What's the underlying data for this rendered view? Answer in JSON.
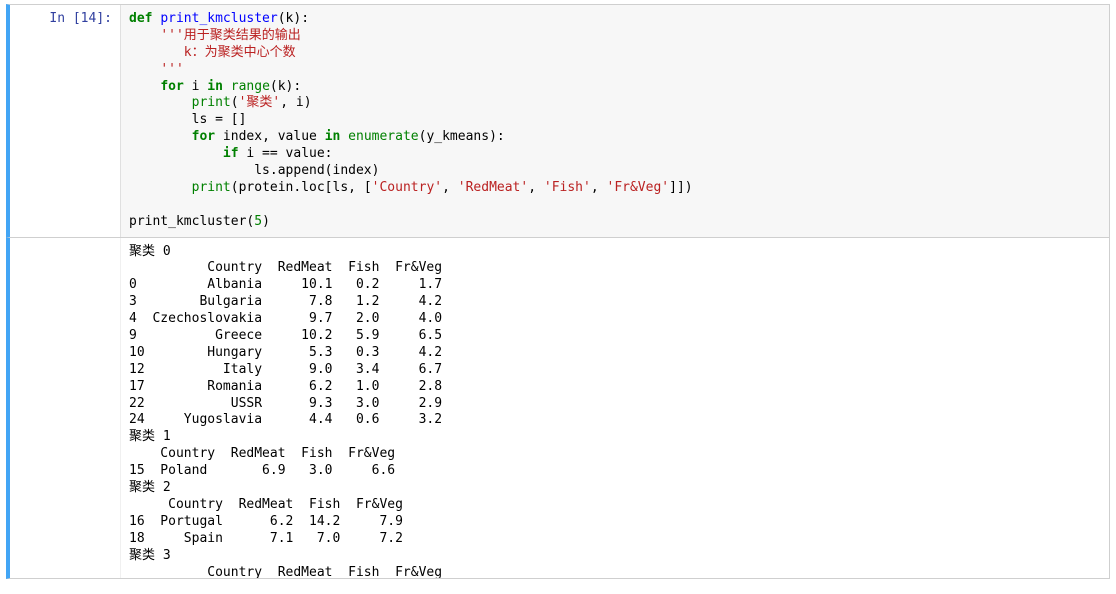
{
  "cell": {
    "prompt_label": "In [14]:",
    "code": {
      "l1_def": "def",
      "l1_fn": "print_kmcluster",
      "l1_rest": "(k):",
      "l2_doc": "'''用于聚类结果的输出",
      "l3_doc": "   k：为聚类中心个数",
      "l4_doc": "'''",
      "l5_for": "for",
      "l5_var": " i ",
      "l5_in": "in",
      "l5_range": " range",
      "l5_rest": "(k):",
      "l6_print": "print",
      "l6_open": "(",
      "l6_str": "'聚类'",
      "l6_rest": ", i)",
      "l7": "ls = []",
      "l8_for": "for",
      "l8_mid": " index, value ",
      "l8_in": "in",
      "l8_enum": " enumerate",
      "l8_rest": "(y_kmeans):",
      "l9_if": "if",
      "l9_rest": " i == value:",
      "l10": "ls.append(index)",
      "l11_print": "print",
      "l11_a": "(protein.loc[ls, [",
      "l11_s1": "'Country'",
      "l11_c1": ", ",
      "l11_s2": "'RedMeat'",
      "l11_c2": ", ",
      "l11_s3": "'Fish'",
      "l11_c3": ", ",
      "l11_s4": "'Fr&Veg'",
      "l11_b": "]])",
      "l13_call": "print_kmcluster(",
      "l13_num": "5",
      "l13_close": ")"
    }
  },
  "output_text": "聚类 0\n          Country  RedMeat  Fish  Fr&Veg\n0         Albania     10.1   0.2     1.7\n3        Bulgaria      7.8   1.2     4.2\n4  Czechoslovakia      9.7   2.0     4.0\n9          Greece     10.2   5.9     6.5\n10        Hungary      5.3   0.3     4.2\n12          Italy      9.0   3.4     6.7\n17        Romania      6.2   1.0     2.8\n22           USSR      9.3   3.0     2.9\n24     Yugoslavia      4.4   0.6     3.2\n聚类 1\n    Country  RedMeat  Fish  Fr&Veg\n15  Poland       6.9   3.0     6.6\n聚类 2\n     Country  RedMeat  Fish  Fr&Veg\n16  Portugal      6.2  14.2     7.9\n18     Spain      7.1   7.0     7.2\n聚类 3\n          Country  RedMeat  Fish  Fr&Veg",
  "chart_data": {
    "type": "table",
    "note": "Clustering output printed as text tables, grouped by cluster id",
    "columns": [
      "index",
      "Country",
      "RedMeat",
      "Fish",
      "Fr&Veg"
    ],
    "clusters": [
      {
        "id": 0,
        "label": "聚类 0",
        "rows": [
          {
            "index": 0,
            "Country": "Albania",
            "RedMeat": 10.1,
            "Fish": 0.2,
            "Fr&Veg": 1.7
          },
          {
            "index": 3,
            "Country": "Bulgaria",
            "RedMeat": 7.8,
            "Fish": 1.2,
            "Fr&Veg": 4.2
          },
          {
            "index": 4,
            "Country": "Czechoslovakia",
            "RedMeat": 9.7,
            "Fish": 2.0,
            "Fr&Veg": 4.0
          },
          {
            "index": 9,
            "Country": "Greece",
            "RedMeat": 10.2,
            "Fish": 5.9,
            "Fr&Veg": 6.5
          },
          {
            "index": 10,
            "Country": "Hungary",
            "RedMeat": 5.3,
            "Fish": 0.3,
            "Fr&Veg": 4.2
          },
          {
            "index": 12,
            "Country": "Italy",
            "RedMeat": 9.0,
            "Fish": 3.4,
            "Fr&Veg": 6.7
          },
          {
            "index": 17,
            "Country": "Romania",
            "RedMeat": 6.2,
            "Fish": 1.0,
            "Fr&Veg": 2.8
          },
          {
            "index": 22,
            "Country": "USSR",
            "RedMeat": 9.3,
            "Fish": 3.0,
            "Fr&Veg": 2.9
          },
          {
            "index": 24,
            "Country": "Yugoslavia",
            "RedMeat": 4.4,
            "Fish": 0.6,
            "Fr&Veg": 3.2
          }
        ]
      },
      {
        "id": 1,
        "label": "聚类 1",
        "rows": [
          {
            "index": 15,
            "Country": "Poland",
            "RedMeat": 6.9,
            "Fish": 3.0,
            "Fr&Veg": 6.6
          }
        ]
      },
      {
        "id": 2,
        "label": "聚类 2",
        "rows": [
          {
            "index": 16,
            "Country": "Portugal",
            "RedMeat": 6.2,
            "Fish": 14.2,
            "Fr&Veg": 7.9
          },
          {
            "index": 18,
            "Country": "Spain",
            "RedMeat": 7.1,
            "Fish": 7.0,
            "Fr&Veg": 7.2
          }
        ]
      },
      {
        "id": 3,
        "label": "聚类 3",
        "rows": []
      }
    ]
  }
}
